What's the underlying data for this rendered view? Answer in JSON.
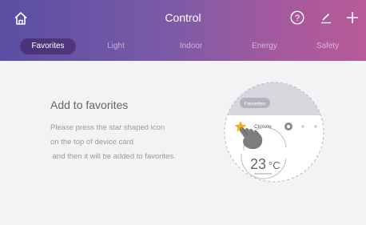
{
  "header": {
    "title": "Control",
    "icons": [
      "home-icon",
      "help-icon",
      "edit-icon",
      "plus-icon"
    ],
    "tabs": [
      {
        "label": "Favorites",
        "active": true
      },
      {
        "label": "Light",
        "active": false
      },
      {
        "label": "Indoor",
        "active": false
      },
      {
        "label": "Energy",
        "active": false
      },
      {
        "label": "Safety",
        "active": false
      }
    ]
  },
  "content": {
    "heading": "Add to favorites",
    "description_lines": [
      "Please press the star shaped icon",
      "on the top of device card",
      " and then it will be added to favorites."
    ]
  },
  "illustration": {
    "tab_label": "Favorites",
    "device_name": "Climate",
    "temperature": "23",
    "temperature_unit": "°C",
    "icons": [
      "star-icon",
      "hand-pointer-icon"
    ]
  },
  "colors": {
    "header_start": "#5a4ea3",
    "header_end": "#b85a97",
    "star": "#f6b21d",
    "background": "#f3f2f4"
  }
}
